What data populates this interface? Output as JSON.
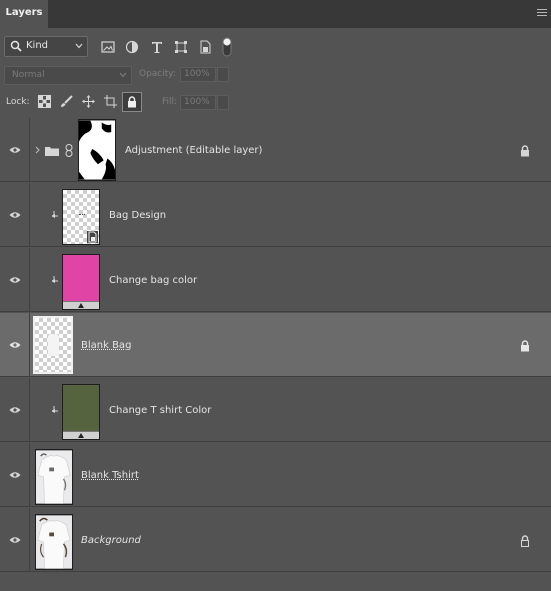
{
  "panel": {
    "tab_label": "Layers"
  },
  "filter": {
    "kind_label": "Kind"
  },
  "blend": {
    "mode": "Normal",
    "opacity_label": "Opacity:",
    "opacity_value": "100%",
    "fill_label": "Fill:",
    "fill_value": "100%"
  },
  "lock": {
    "label": "Lock:"
  },
  "colors": {
    "change_bag": "#e044a4",
    "change_tshirt": "#56633f",
    "panel_bg": "#535353",
    "selected_row": "#6b6b6b"
  },
  "layers": [
    {
      "name": "Adjustment (Editable layer)",
      "type": "group",
      "locked": true
    },
    {
      "name": "Bag Design",
      "type": "smart-object",
      "clipped": true
    },
    {
      "name": "Change bag color",
      "type": "color-fill",
      "clipped": true
    },
    {
      "name": "Blank Bag",
      "type": "pixel",
      "selected": true,
      "locked": true
    },
    {
      "name": "Change T shirt Color",
      "type": "color-fill",
      "clipped": true
    },
    {
      "name": "Blank Tshirt",
      "type": "pixel"
    },
    {
      "name": "Background",
      "type": "background",
      "locked": true
    }
  ]
}
